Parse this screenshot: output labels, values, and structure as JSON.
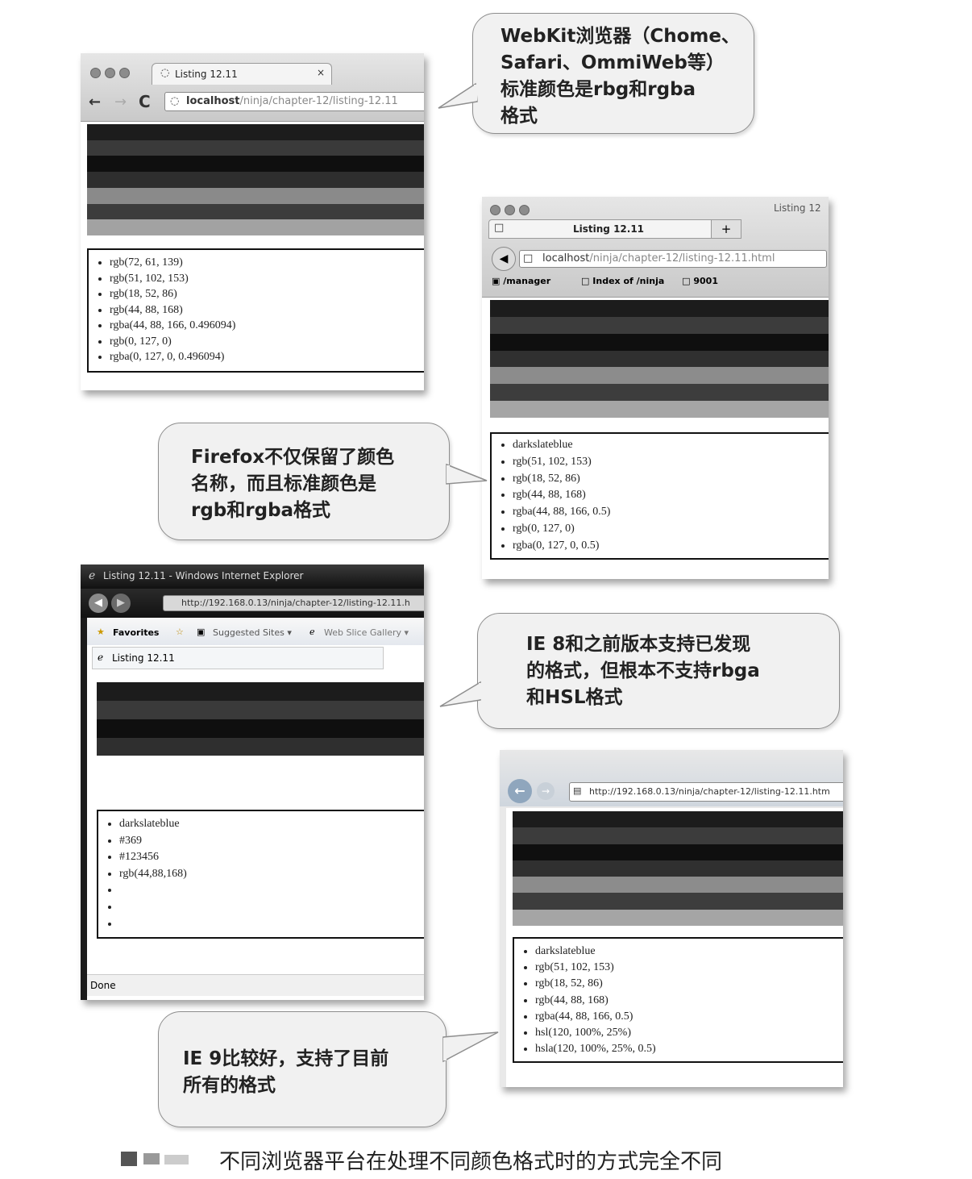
{
  "chrome": {
    "tab_title": "Listing 12.11",
    "url_host": "localhost",
    "url_path": "/ninja/chapter-12/listing-12.11",
    "items": [
      "rgb(72, 61, 139)",
      "rgb(51, 102, 153)",
      "rgb(18, 52, 86)",
      "rgb(44, 88, 168)",
      "rgba(44, 88, 166, 0.496094)",
      "rgb(0, 127, 0)",
      "rgba(0, 127, 0, 0.496094)"
    ]
  },
  "firefox": {
    "window_title": "Listing 12",
    "tab_title": "Listing 12.11",
    "url_host": "localhost",
    "url_path": "/ninja/chapter-12/listing-12.11.html",
    "bookmarks": [
      "/manager",
      "Index of /ninja",
      "9001"
    ],
    "items": [
      "darkslateblue",
      "rgb(51, 102, 153)",
      "rgb(18, 52, 86)",
      "rgb(44, 88, 168)",
      "rgba(44, 88, 166, 0.5)",
      "rgb(0, 127, 0)",
      "rgba(0, 127, 0, 0.5)"
    ]
  },
  "ie8": {
    "window_title": "Listing 12.11 - Windows Internet Explorer",
    "url": "http://192.168.0.13/ninja/chapter-12/listing-12.11.h",
    "favorites": "Favorites",
    "suggested": "Suggested Sites ▾",
    "web_slice": "Web Slice Gallery ▾",
    "tab_title": "Listing 12.11",
    "status": "Done",
    "items": [
      "darkslateblue",
      "#369",
      "#123456",
      "rgb(44,88,168)",
      "",
      "",
      ""
    ]
  },
  "ie9": {
    "url": "http://192.168.0.13/ninja/chapter-12/listing-12.11.htm",
    "items": [
      "darkslateblue",
      "rgb(51, 102, 153)",
      "rgb(18, 52, 86)",
      "rgb(44, 88, 168)",
      "rgba(44, 88, 166, 0.5)",
      "hsl(120, 100%, 25%)",
      "hsla(120, 100%, 25%, 0.5)"
    ]
  },
  "callouts": {
    "webkit": "WebKit浏览器（Chome、\nSafari、OmmiWeb等）\n标准颜色是rbg和rgba\n格式",
    "firefox": "Firefox不仅保留了颜色\n名称，而且标准颜色是\nrgb和rgba格式",
    "ie8": "IE 8和之前版本支持已发现\n的格式，但根本不支持rbga\n和HSL格式",
    "ie9": "IE 9比较好，支持了目前\n所有的格式"
  },
  "caption": "不同浏览器平台在处理不同颜色格式时的方式完全不同",
  "stripe_colors": {
    "chrome": [
      "#1c1c1c",
      "#3a3a3a",
      "#0f0f0f",
      "#2e2e2e",
      "#8a8a8a",
      "#3c3c3c",
      "#a2a2a2"
    ],
    "firefox": [
      "#1c1c1c",
      "#3c3c3c",
      "#0f0f0f",
      "#303030",
      "#8c8c8c",
      "#3d3d3d",
      "#a5a5a5"
    ],
    "ie8": [
      "#1c1c1c",
      "#3a3a3a",
      "#0f0f0f",
      "#2f2f2f",
      "#ffffff",
      "#ffffff",
      "#ffffff"
    ],
    "ie9": [
      "#1c1c1c",
      "#3c3c3c",
      "#0f0f0f",
      "#303030",
      "#8c8c8c",
      "#3d3d3d",
      "#a5a5a5"
    ]
  }
}
